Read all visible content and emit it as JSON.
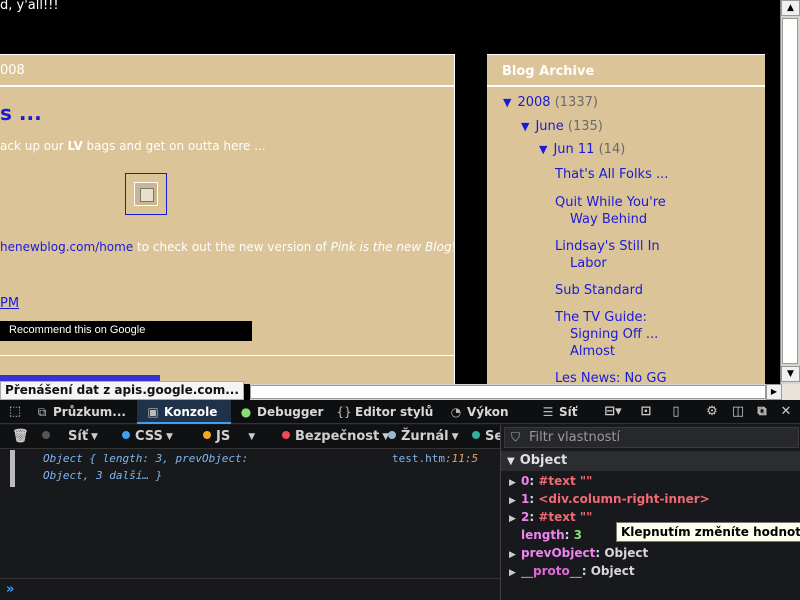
{
  "page": {
    "top_text": "d, y'all!!!",
    "date_header": "008",
    "post_title": "s ...",
    "post_body1_pre": "ack up our ",
    "post_body1_bold": "LV",
    "post_body1_post": " bags and get on outta here ...",
    "post_body2_link": "henewblog.com/home",
    "post_body2_mid": " to check out the new version of ",
    "post_body2_italic": "Pink is the new Blog",
    "post_body2_end": "!",
    "post_time": " PM",
    "recommend": "Recommend this on Google",
    "status_tip": "Přenášení dat z apis.google.com..."
  },
  "archive": {
    "title": "Blog Archive",
    "year": "2008",
    "year_count": "(1337)",
    "month": "June",
    "month_count": "(135)",
    "day": "Jun 11",
    "day_count": "(14)",
    "links": [
      {
        "l1": "That's All Folks ...",
        "l2": ""
      },
      {
        "l1": "Quit While You're",
        "l2": "Way Behind"
      },
      {
        "l1": "Lindsay's Still In",
        "l2": "Labor"
      },
      {
        "l1": "Sub Standard",
        "l2": ""
      },
      {
        "l1": "The TV Guide:",
        "l2": "Signing Off ...",
        "l3": "Almost"
      },
      {
        "l1": "Les News: No GG",
        "l2": ""
      }
    ]
  },
  "devtools": {
    "tabs": {
      "inspector": "Průzkum...",
      "console": "Konzole",
      "debugger": "Debugger",
      "style": "Editor stylů",
      "performance": "Výkon",
      "network": "Síť"
    },
    "filters": {
      "net": "Síť",
      "css": "CSS",
      "js": "JS",
      "security": "Bezpečnost",
      "log": "Žurnál",
      "se": "Se"
    },
    "colors": {
      "net": "#888888",
      "css": "#3ea1f5",
      "js": "#f5a623",
      "security": "#f0485a",
      "log": "#9bb7d4"
    },
    "console": {
      "line1": "Object { length: 3, prevObject:",
      "line2": "Object, 3 další… }",
      "source_file": "test.htm",
      "source_line": ":11:5",
      "prompt": "»"
    },
    "panel": {
      "filter_placeholder": "Filtr vlastností",
      "header": "Object",
      "props": [
        {
          "key": "0",
          "value": "#text \"\""
        },
        {
          "key": "1",
          "value": "<div.column-right-inner>"
        },
        {
          "key": "2",
          "value": "#text \"\""
        },
        {
          "key": "length",
          "value": "3"
        },
        {
          "key": "prevObject",
          "value": "Object"
        },
        {
          "key": "__proto__",
          "value": "Object"
        }
      ],
      "tooltip": "Klepnutím změníte hodnotu"
    }
  }
}
